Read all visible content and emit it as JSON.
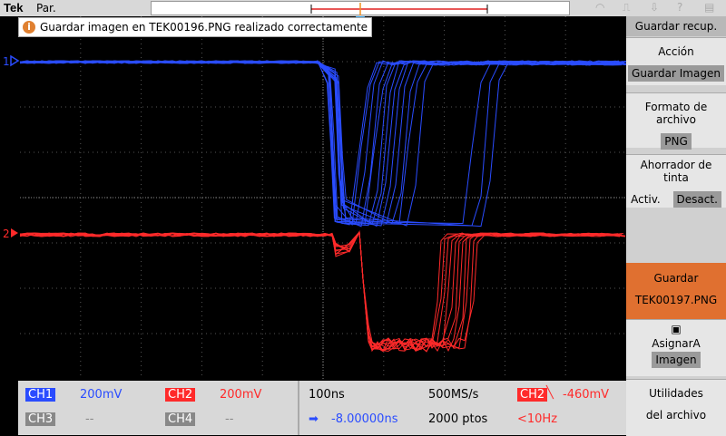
{
  "top": {
    "brand": "Tek",
    "mode": "Par."
  },
  "trigger_marker": "T",
  "message": {
    "text": "Guardar imagen en TEK00196.PNG realizado correctamente",
    "icon": "info-icon"
  },
  "channel_markers": [
    {
      "label": "1",
      "color": "#2a4cff"
    },
    {
      "label": "2",
      "color": "#ff2a2a"
    }
  ],
  "menu": {
    "title": "Guardar recup.",
    "accion_label": "Acción",
    "accion_value": "Guardar Imagen",
    "formato_label": "Formato de archivo",
    "formato_value": "PNG",
    "ahorrador_label": "Ahorrador de tinta",
    "ahorrador_on": "Activ.",
    "ahorrador_off": "Desact.",
    "guardar_label": "Guardar",
    "guardar_file": "TEK00197.PNG",
    "asignar_label": "AsignarA",
    "asignar_value": "Imagen",
    "utilidades_line1": "Utilidades",
    "utilidades_line2": "del archivo"
  },
  "readout": {
    "ch1": {
      "label": "CH1",
      "value": "200mV",
      "color": "#2a4cff"
    },
    "ch2": {
      "label": "CH2",
      "value": "200mV",
      "color": "#ff2a2a"
    },
    "ch3": {
      "label": "CH3",
      "value": "--"
    },
    "ch4": {
      "label": "CH4",
      "value": "--"
    },
    "timebase": "100ns",
    "sample_rate": "500MS/s",
    "position": "-8.00000ns",
    "record_length": "2000 ptos",
    "trigger_channel": "CH2",
    "trigger_level": "-460mV",
    "trigger_freq": "<10Hz"
  },
  "colors": {
    "ch1": "#2a4cff",
    "ch2": "#ff2a2a",
    "save_button": "#e07030"
  }
}
